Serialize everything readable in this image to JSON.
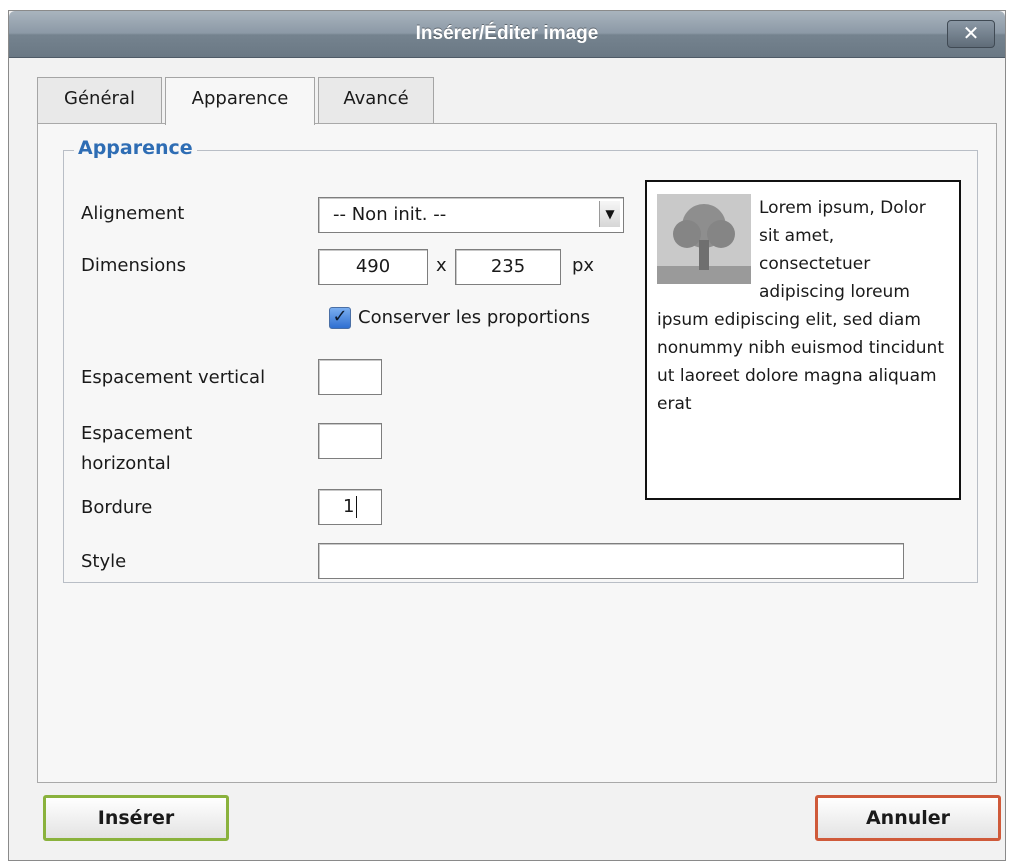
{
  "window": {
    "title": "Insérer/Éditer image",
    "close_label": "✕"
  },
  "tabs": [
    {
      "label": "Général",
      "active": false
    },
    {
      "label": "Apparence",
      "active": true
    },
    {
      "label": "Avancé",
      "active": false
    }
  ],
  "fieldset": {
    "legend": "Apparence"
  },
  "fields": {
    "alignment": {
      "label": "Alignement",
      "value": "-- Non init. --"
    },
    "dimensions": {
      "label": "Dimensions",
      "width": "490",
      "separator": "x",
      "height": "235",
      "unit": "px"
    },
    "keep_ratio": {
      "label": "Conserver les proportions",
      "checked": true
    },
    "vspace": {
      "label": "Espacement vertical",
      "value": ""
    },
    "hspace": {
      "label_line1": "Espacement",
      "label_line2": "horizontal",
      "value": ""
    },
    "border": {
      "label": "Bordure",
      "value": "1"
    },
    "style": {
      "label": "Style",
      "value": ""
    }
  },
  "preview": {
    "text": "Lorem ipsum, Dolor sit amet, consectetuer adipiscing loreum ipsum edipiscing elit, sed diam nonummy nibh euismod tincidunt ut laoreet dolore magna aliquam erat"
  },
  "buttons": {
    "insert": "Insérer",
    "cancel": "Annuler"
  },
  "colors": {
    "accent": "#2e6db4",
    "insert_border": "#8ab23d",
    "cancel_border": "#cf5a3a"
  }
}
